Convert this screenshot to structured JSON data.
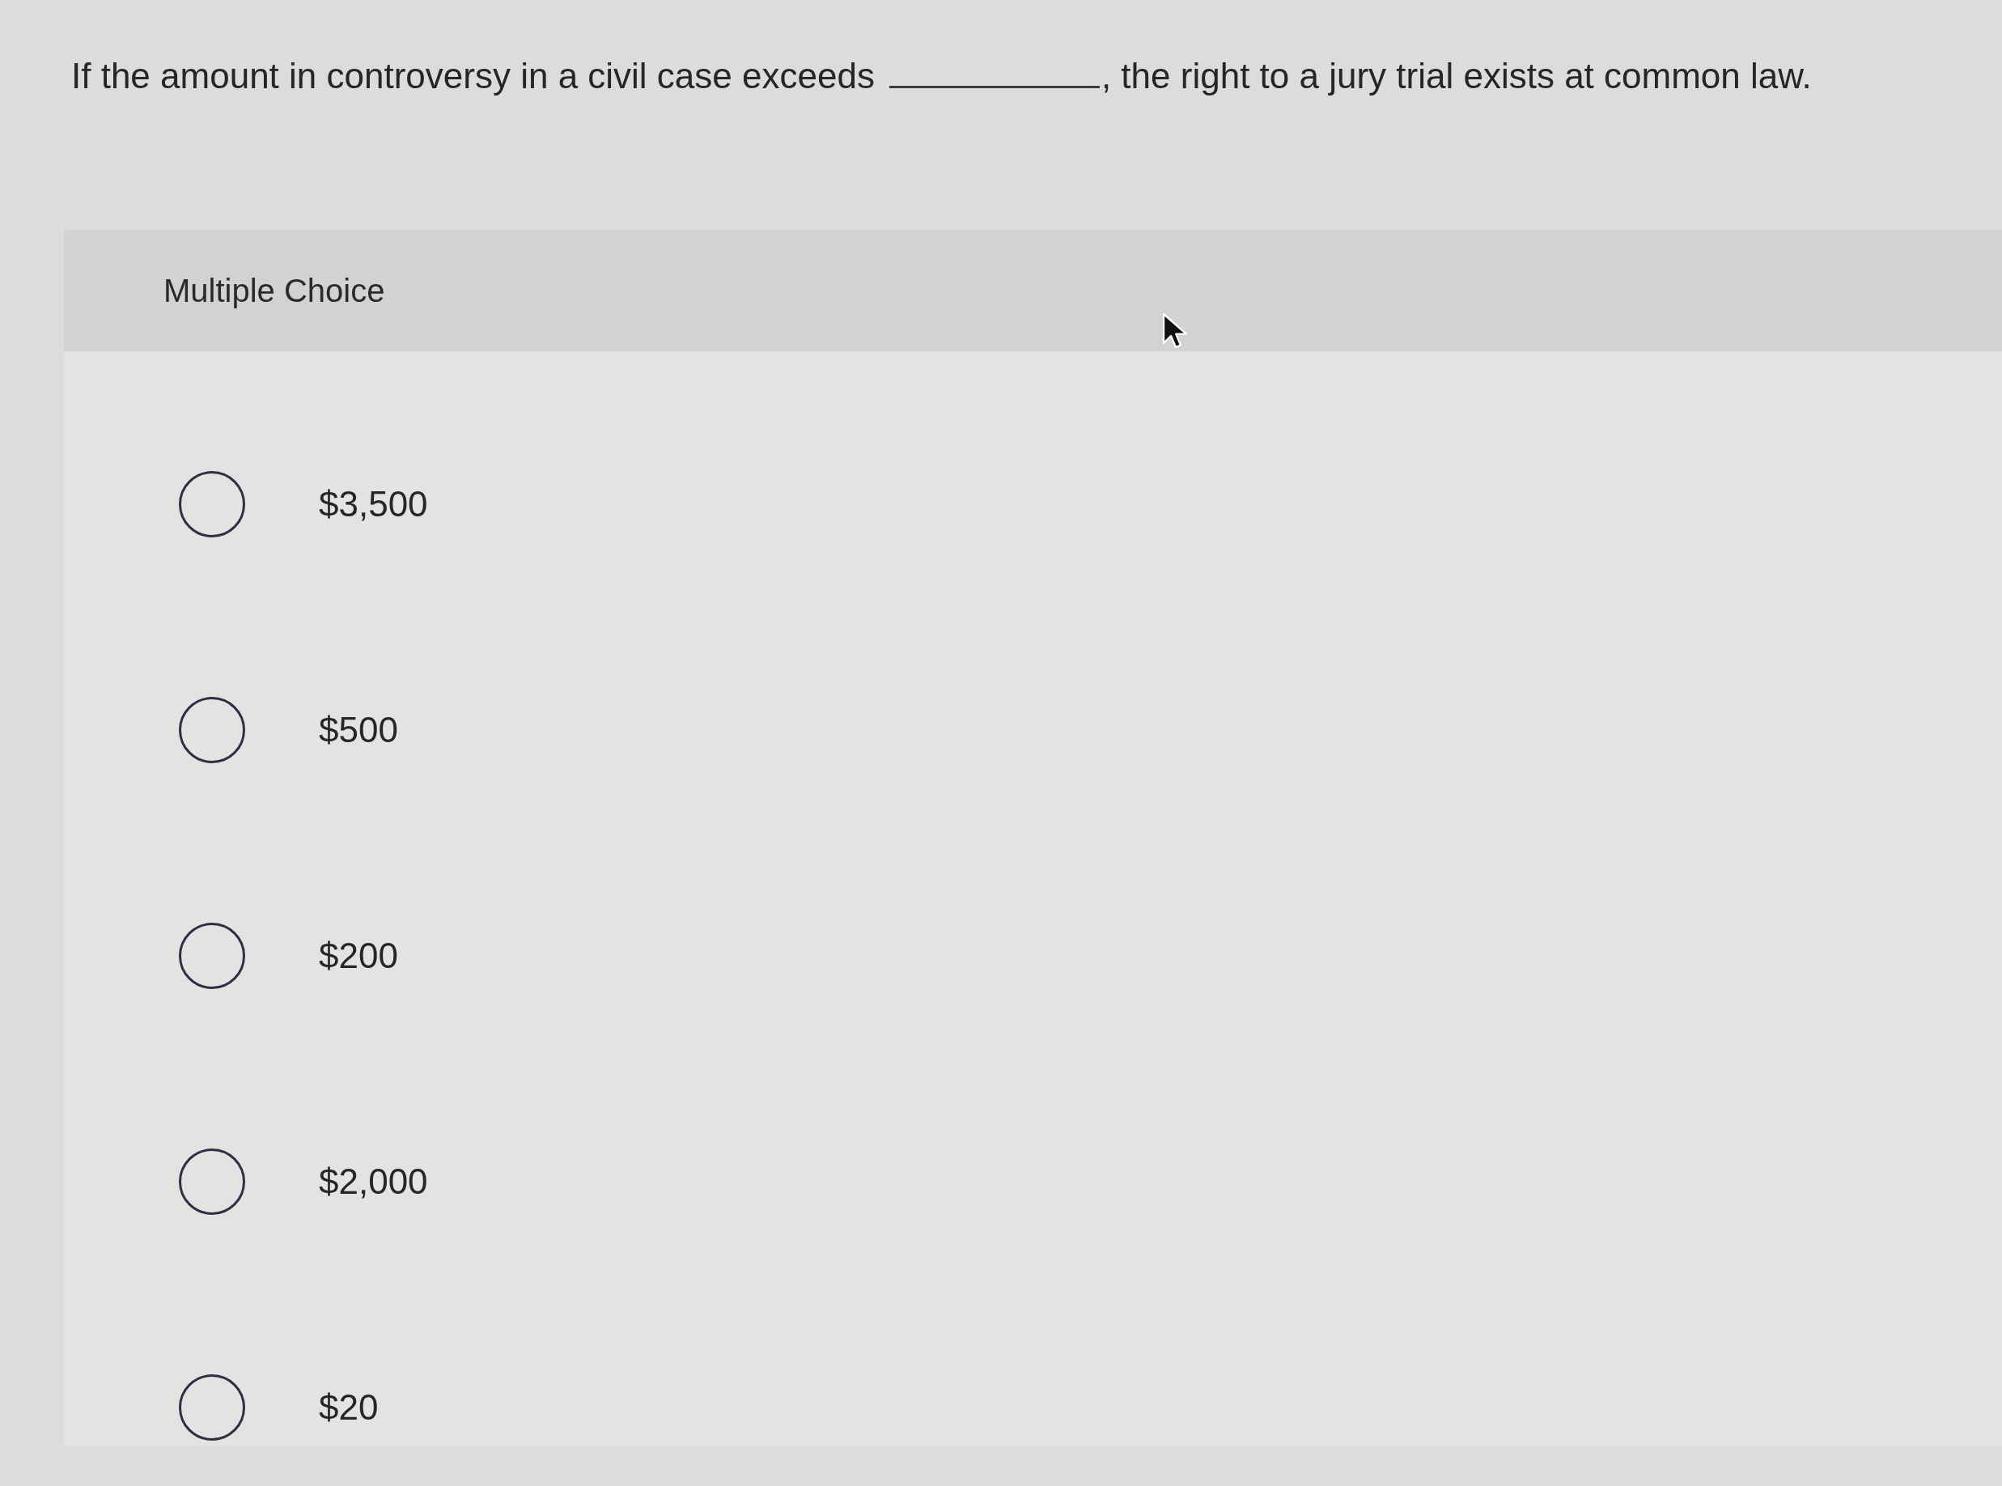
{
  "question": {
    "before": "If the amount in controversy in a civil case exceeds",
    "after": ", the right to a jury trial exists at common law."
  },
  "panel": {
    "title": "Multiple Choice"
  },
  "options": [
    {
      "label": "$3,500",
      "selected": false
    },
    {
      "label": "$500",
      "selected": false
    },
    {
      "label": "$200",
      "selected": false
    },
    {
      "label": "$2,000",
      "selected": false
    },
    {
      "label": "$20",
      "selected": false
    }
  ]
}
